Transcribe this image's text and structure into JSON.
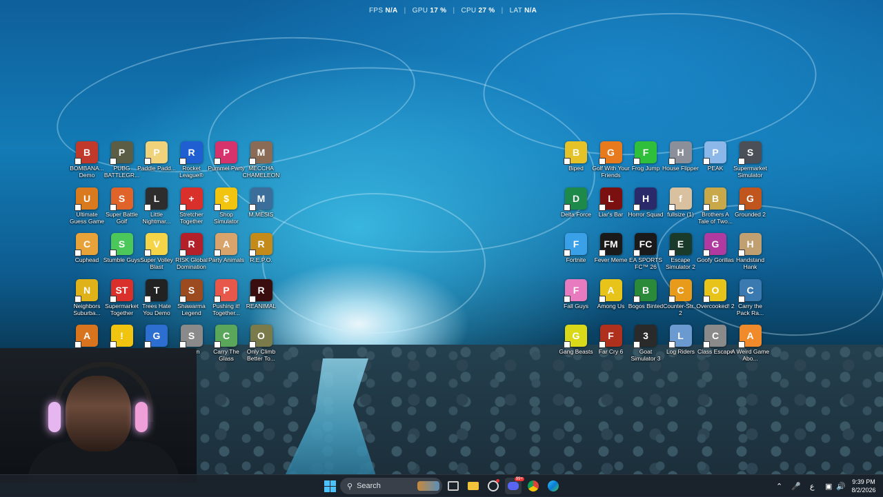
{
  "osd": {
    "fps_label": "FPS",
    "fps_value": "N/A",
    "gpu_label": "GPU",
    "gpu_value": "17 %",
    "cpu_label": "CPU",
    "cpu_value": "27 %",
    "lat_label": "LAT",
    "lat_value": "N/A"
  },
  "desktop_icons_left": [
    {
      "label": "BOMBANA... Demo",
      "color": "#c0392b",
      "glyph": "B"
    },
    {
      "label": "PUBG BATTLEGR...",
      "color": "#5b5e45",
      "glyph": "P"
    },
    {
      "label": "Paddle Padd...",
      "color": "#f0d27a",
      "glyph": "P"
    },
    {
      "label": "Rocket League®",
      "color": "#1f5fd1",
      "glyph": "R"
    },
    {
      "label": "Pummel Party",
      "color": "#d6336c",
      "glyph": "P"
    },
    {
      "label": "MECCHA CHAMELEON",
      "color": "#8a6b55",
      "glyph": "M"
    },
    {
      "label": "Ultimate Guess Game",
      "color": "#d97a1e",
      "glyph": "U"
    },
    {
      "label": "Super Battle Golf",
      "color": "#e0642a",
      "glyph": "S"
    },
    {
      "label": "Little Nightmar...",
      "color": "#2d2d2d",
      "glyph": "L"
    },
    {
      "label": "Stretcher Together",
      "color": "#d9302c",
      "glyph": "+"
    },
    {
      "label": "Shop Simulator",
      "color": "#f1c40f",
      "glyph": "$"
    },
    {
      "label": "M.MESIS",
      "color": "#3c6e9c",
      "glyph": "M"
    },
    {
      "label": "Cuphead",
      "color": "#e8a23a",
      "glyph": "C"
    },
    {
      "label": "Stumble Guys",
      "color": "#4cc85a",
      "glyph": "S"
    },
    {
      "label": "Super Volley Blast",
      "color": "#f5d547",
      "glyph": "V"
    },
    {
      "label": "RISK Global Domination",
      "color": "#b3202a",
      "glyph": "R"
    },
    {
      "label": "Party Animals",
      "color": "#d9a46b",
      "glyph": "A"
    },
    {
      "label": "R.E.P.O.",
      "color": "#c48a1a",
      "glyph": "R"
    },
    {
      "label": "Neighbors Suburba...",
      "color": "#e0b21a",
      "glyph": "N"
    },
    {
      "label": "Supermarket Together",
      "color": "#d9302c",
      "glyph": "ST"
    },
    {
      "label": "Trees Hate You Demo",
      "color": "#222222",
      "glyph": "T"
    },
    {
      "label": "Shawarma Legend",
      "color": "#9c4a20",
      "glyph": "S"
    },
    {
      "label": "Pushing it! Together...",
      "color": "#e8584a",
      "glyph": "P"
    },
    {
      "label": "REANIMAL",
      "color": "#3a0e0e",
      "glyph": "R"
    },
    {
      "label": "",
      "color": "#d9741e",
      "glyph": "A"
    },
    {
      "label": "",
      "color": "#f1c40f",
      "glyph": "!"
    },
    {
      "label": "",
      "color": "#2d6fd1",
      "glyph": "G"
    },
    {
      "label": "...eam",
      "color": "#8a8a8a",
      "glyph": "S"
    },
    {
      "label": "Carry The Glass",
      "color": "#5aa65a",
      "glyph": "C"
    },
    {
      "label": "Only Climb Better To...",
      "color": "#7a7a4a",
      "glyph": "O"
    }
  ],
  "desktop_icons_right": [
    {
      "label": "Biped",
      "color": "#e6c229",
      "glyph": "B"
    },
    {
      "label": "Golf With Your Friends",
      "color": "#e87a1e",
      "glyph": "G"
    },
    {
      "label": "Frog Jump",
      "color": "#2fbf3a",
      "glyph": "F"
    },
    {
      "label": "House Flipper",
      "color": "#8a8f99",
      "glyph": "H"
    },
    {
      "label": "PEAK",
      "color": "#8bb8e8",
      "glyph": "P"
    },
    {
      "label": "Supermarket Simulator",
      "color": "#4a4f58",
      "glyph": "S"
    },
    {
      "label": "Delta Force",
      "color": "#1e8a4a",
      "glyph": "D"
    },
    {
      "label": "Liar's Bar",
      "color": "#7a1010",
      "glyph": "L"
    },
    {
      "label": "Horror Squad",
      "color": "#2a2a6a",
      "glyph": "H"
    },
    {
      "label": "fullsize (1)",
      "color": "#d9c1a0",
      "glyph": "f"
    },
    {
      "label": "Brothers A Tale of Two...",
      "color": "#c9a84a",
      "glyph": "B"
    },
    {
      "label": "Grounded 2",
      "color": "#c0551e",
      "glyph": "G"
    },
    {
      "label": "Fortnite",
      "color": "#3aa0e8",
      "glyph": "F"
    },
    {
      "label": "Fever Meme",
      "color": "#1a1a1a",
      "glyph": "FM"
    },
    {
      "label": "EA SPORTS FC™ 26",
      "color": "#1a1a1a",
      "glyph": "FC"
    },
    {
      "label": "Escape Simulator 2",
      "color": "#1a3a2a",
      "glyph": "E"
    },
    {
      "label": "Goofy Gorillas",
      "color": "#b03aa0",
      "glyph": "G"
    },
    {
      "label": "Handstand Hank",
      "color": "#c0a070",
      "glyph": "H"
    },
    {
      "label": "Fall Guys",
      "color": "#e87ac0",
      "glyph": "F"
    },
    {
      "label": "Among Us",
      "color": "#e8c41a",
      "glyph": "A"
    },
    {
      "label": "Bogos Binted",
      "color": "#2a8a3a",
      "glyph": "B"
    },
    {
      "label": "Counter-Str... 2",
      "color": "#e89a1a",
      "glyph": "C"
    },
    {
      "label": "Overcooked! 2",
      "color": "#e8c41a",
      "glyph": "O"
    },
    {
      "label": "Carry the Pack Ra...",
      "color": "#3a7ab0",
      "glyph": "C"
    },
    {
      "label": "Gang Beasts",
      "color": "#d9d91a",
      "glyph": "G"
    },
    {
      "label": "Far Cry 6",
      "color": "#b0301e",
      "glyph": "F"
    },
    {
      "label": "Goat Simulator 3",
      "color": "#2a2a2a",
      "glyph": "3"
    },
    {
      "label": "Log Riders",
      "color": "#6a9ad0",
      "glyph": "L"
    },
    {
      "label": "Class Escape",
      "color": "#8a8a8a",
      "glyph": "C"
    },
    {
      "label": "A Weird Game Abo...",
      "color": "#f08a2a",
      "glyph": "A"
    }
  ],
  "taskbar": {
    "search_placeholder": "Search",
    "discord_badge": "99+",
    "tray_lang": "ع",
    "clock_time": "9:39 PM",
    "clock_date": "8/2/2026"
  }
}
